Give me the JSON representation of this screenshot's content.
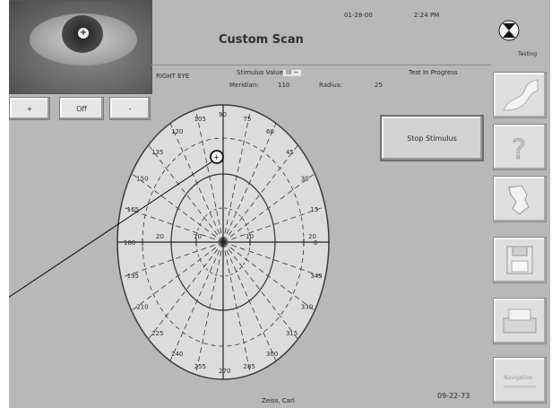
{
  "header": {
    "date": "01-28-00",
    "time": "2:24 PM",
    "title": "Custom Scan",
    "status_icon_label": "Testing"
  },
  "camera": {
    "buttons": {
      "minus": "+",
      "toggle": "Off",
      "plus": "-"
    }
  },
  "test_info": {
    "eye": "RIGHT EYE",
    "stimulus_label": "Stimulus Value:",
    "stimulus_value": "III ~",
    "meridian_label": "Meridian:",
    "meridian_value": "110",
    "radius_label": "Radius:",
    "radius_value": "25",
    "progress": "Test In Progress"
  },
  "controls": {
    "stop_label": "Stop Stimulus"
  },
  "perimeter": {
    "angle_labels": [
      "105",
      "90",
      "75",
      "60",
      "45",
      "30",
      "15",
      "0",
      "345",
      "330",
      "315",
      "300",
      "285",
      "270",
      "255",
      "240",
      "225",
      "210",
      "195",
      "180",
      "165",
      "150",
      "135",
      "120"
    ],
    "radius_labels": [
      "20",
      "10",
      "10",
      "20"
    ]
  },
  "footer": {
    "patient": "Zeiss, Carl",
    "patient_date": "09-22-73"
  },
  "sidebar": {
    "icons": [
      "curve-icon",
      "help-icon",
      "profile-icon",
      "save-disk-icon",
      "printer-icon",
      "navigation-icon"
    ],
    "nav_text": "Navigation"
  }
}
